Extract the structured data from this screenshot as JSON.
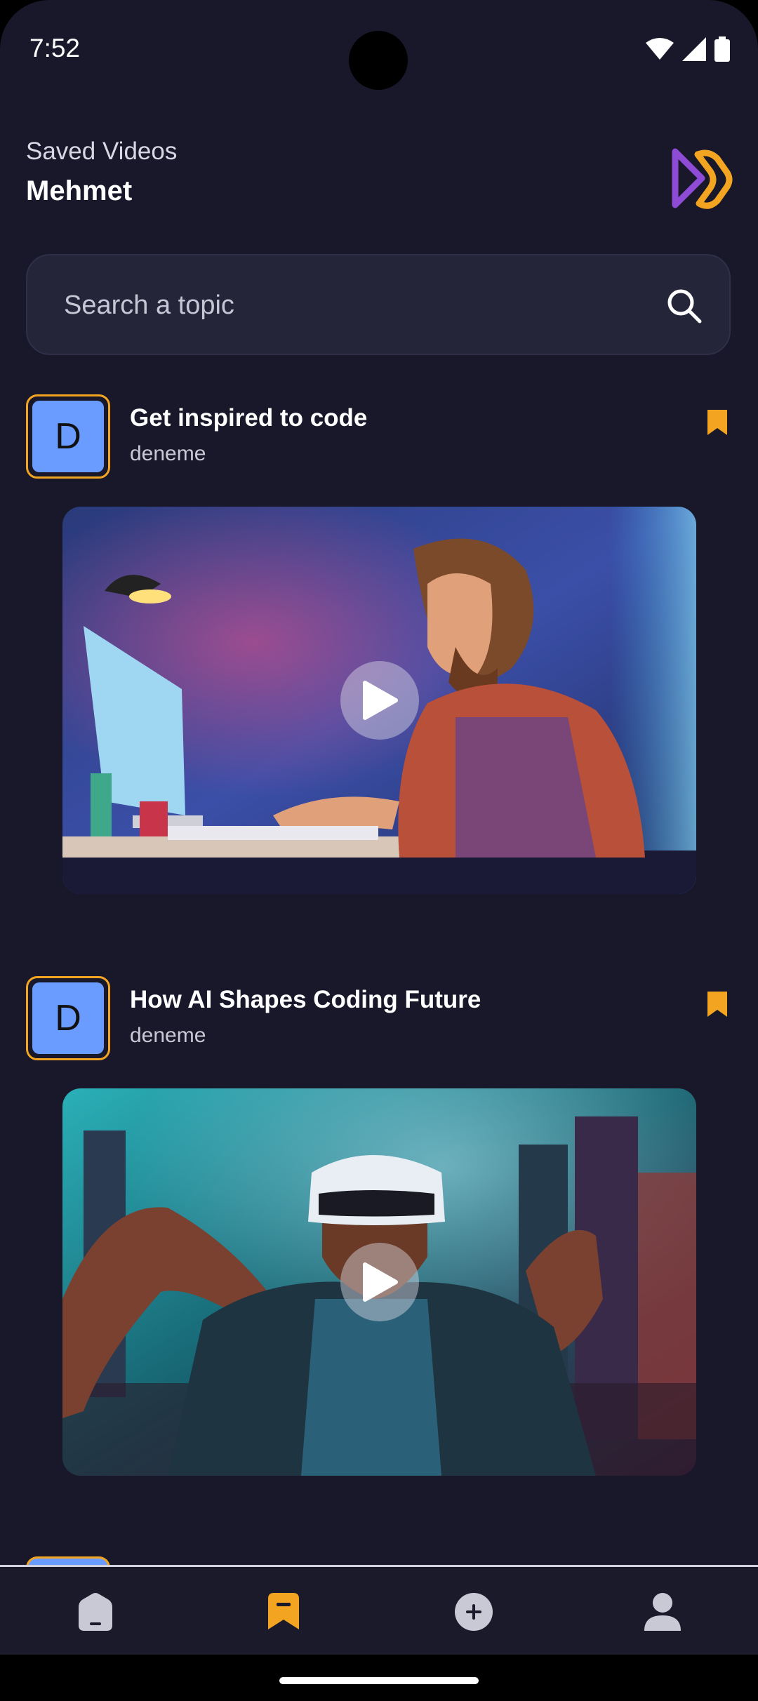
{
  "status_bar": {
    "time": "7:52"
  },
  "header": {
    "subtitle": "Saved Videos",
    "user_name": "Mehmet"
  },
  "search": {
    "placeholder": "Search a topic",
    "value": ""
  },
  "posts": [
    {
      "avatar_letter": "D",
      "title": "Get inspired to code",
      "author": "deneme",
      "bookmarked": true
    },
    {
      "avatar_letter": "D",
      "title": "How AI Shapes Coding Future",
      "author": "deneme",
      "bookmarked": true
    }
  ],
  "nav": {
    "items": [
      "home-icon",
      "bookmark-icon",
      "add-icon",
      "profile-icon"
    ],
    "active": "bookmark-icon"
  },
  "colors": {
    "background": "#18182a",
    "accent": "#f3a521",
    "avatar_fill": "#6a9bff",
    "logo_purple": "#8e4bd6",
    "logo_orange": "#f3a521"
  }
}
